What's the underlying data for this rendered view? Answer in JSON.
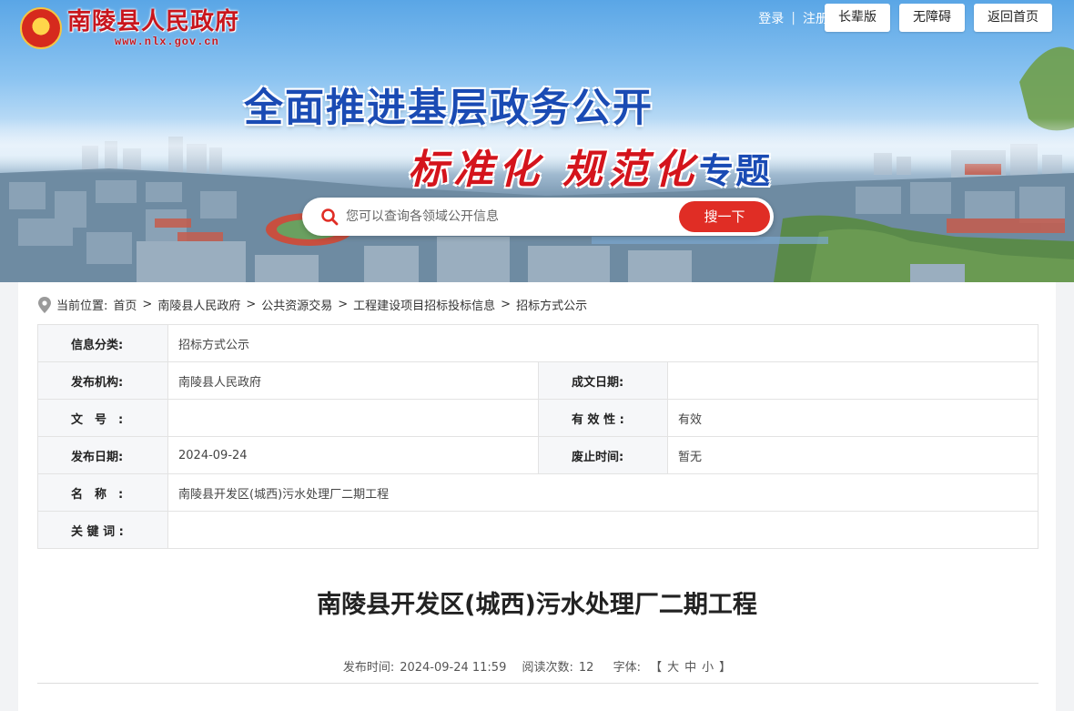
{
  "site": {
    "title": "南陵县人民政府",
    "url": "www.nlx.gov.cn"
  },
  "top_links": {
    "login": "登录",
    "divider": "|",
    "register": "注册"
  },
  "top_buttons": [
    {
      "label": "长辈版"
    },
    {
      "label": "无障碍"
    },
    {
      "label": "返回首页"
    }
  ],
  "banner": {
    "headline1": "全面推进基层政务公开",
    "headline2_a": "标准化",
    "headline2_b": "规范化",
    "headline2_topic": "专题"
  },
  "search": {
    "placeholder": "您可以查询各领域公开信息",
    "button": "搜一下"
  },
  "breadcrumb": {
    "prefix": "当前位置:",
    "items": [
      "首页",
      "南陵县人民政府",
      "公共资源交易",
      "工程建设项目招标投标信息",
      "招标方式公示"
    ],
    "arrow": ">"
  },
  "info_table": {
    "category_label": "信息分类:",
    "category": "招标方式公示",
    "publisher_label": "发布机构:",
    "publisher": "南陵县人民政府",
    "written_date_label": "成文日期:",
    "written_date": "",
    "doc_no_label": "文号:",
    "doc_no": "",
    "validity_label": "有效性:",
    "validity": "有效",
    "publish_date_label": "发布日期:",
    "publish_date": "2024-09-24",
    "expire_label": "废止时间:",
    "expire": "暂无",
    "name_label": "名称:",
    "name": "南陵县开发区(城西)污水处理厂二期工程",
    "keywords_label": "关键词:",
    "keywords": ""
  },
  "article": {
    "title": "南陵县开发区(城西)污水处理厂二期工程",
    "publish_time_label": "发布时间:",
    "publish_time": "2024-09-24 11:59",
    "views_label": "阅读次数:",
    "views": "12",
    "font_label": "字体:",
    "font_open": "【",
    "font_large": "大",
    "font_medium": "中",
    "font_small": "小",
    "font_close": "】"
  },
  "colors": {
    "brand_red": "#c8161d",
    "headline_blue": "#1a4bb4",
    "search_button": "#e02d25"
  }
}
